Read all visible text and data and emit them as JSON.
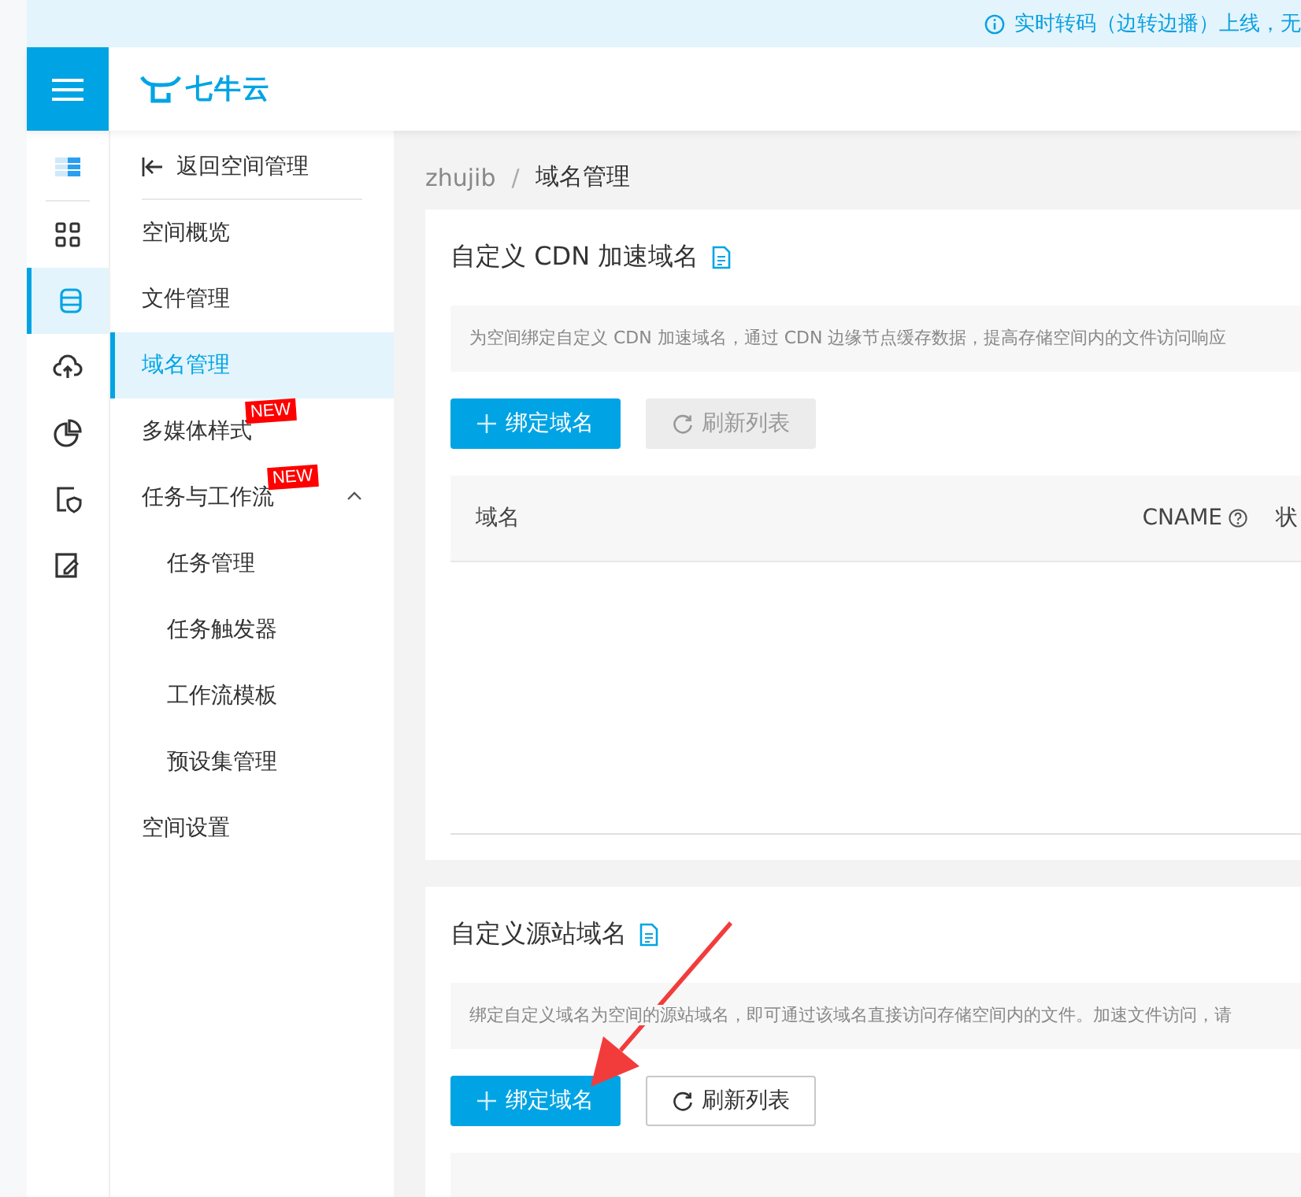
{
  "banner": {
    "text": "实时转码（边转边播）上线，无"
  },
  "header": {
    "logo_text": "七牛云"
  },
  "rail": [
    {
      "kind": "storage",
      "selected": false
    },
    {
      "kind": "grid",
      "selected": false
    },
    {
      "kind": "database",
      "selected": true
    },
    {
      "kind": "cloud",
      "selected": false
    },
    {
      "kind": "pie",
      "selected": false
    },
    {
      "kind": "shield",
      "selected": false
    },
    {
      "kind": "edit",
      "selected": false
    }
  ],
  "nav": {
    "back": "返回空间管理",
    "items": [
      {
        "label": "空间概览",
        "selected": false
      },
      {
        "label": "文件管理",
        "selected": false
      },
      {
        "label": "域名管理",
        "selected": true
      },
      {
        "label": "多媒体样式",
        "selected": false,
        "badge": "NEW"
      },
      {
        "label": "任务与工作流",
        "selected": false,
        "badge": "NEW",
        "expanded": true,
        "children": [
          {
            "label": "任务管理",
            "selected": false
          },
          {
            "label": "任务触发器",
            "selected": false
          },
          {
            "label": "工作流模板",
            "selected": false
          },
          {
            "label": "预设集管理",
            "selected": false
          }
        ]
      },
      {
        "label": "空间设置",
        "selected": false
      }
    ]
  },
  "breadcrumb": {
    "items": [
      "zhujib",
      "域名管理"
    ],
    "separator": "/"
  },
  "cards": [
    {
      "title": "自定义 CDN 加速域名",
      "description": "为空间绑定自定义 CDN 加速域名，通过 CDN 边缘节点缓存数据，提高存储空间内的文件访问响应",
      "buttons": [
        {
          "label": "绑定域名",
          "kind": "primary",
          "disabled": false
        },
        {
          "label": "刷新列表",
          "kind": "refresh",
          "disabled": true
        }
      ],
      "table": {
        "columns": [
          "域名",
          "CNAME",
          "状"
        ]
      }
    },
    {
      "title": "自定义源站域名",
      "description": "绑定自定义域名为空间的源站域名，即可通过该域名直接访问存储空间内的文件。加速文件访问，请",
      "buttons": [
        {
          "label": "绑定域名",
          "kind": "primary",
          "disabled": false
        },
        {
          "label": "刷新列表",
          "kind": "refresh",
          "disabled": false
        }
      ]
    }
  ]
}
